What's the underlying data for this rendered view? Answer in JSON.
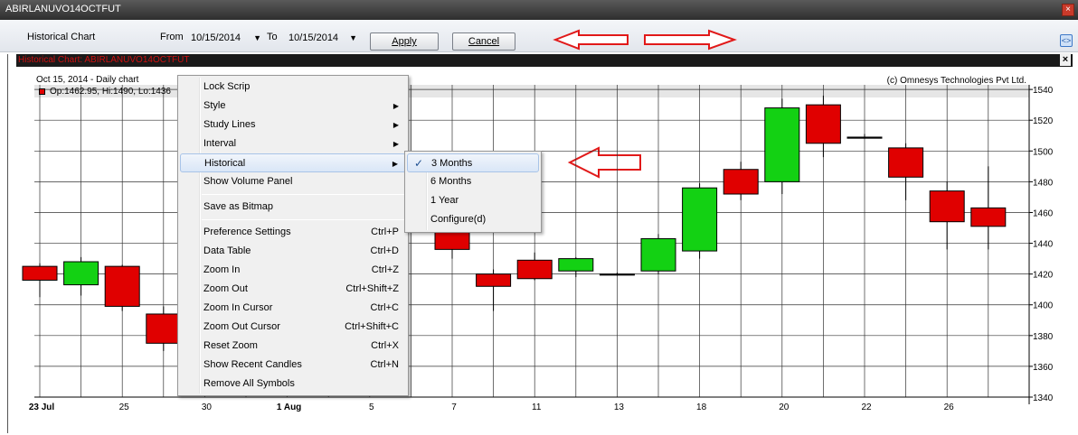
{
  "window": {
    "title": "ABIRLANUVO14OCTFUT"
  },
  "toolbar": {
    "title": "Historical Chart",
    "from_label": "From",
    "from_value": "10/15/2014",
    "to_label": "To",
    "to_value": "10/15/2014",
    "apply_label": "Apply",
    "cancel_label": "Cancel"
  },
  "chart_window": {
    "title": "Historical Chart: ABIRLANUVO14OCTFUT"
  },
  "chart_info": {
    "date_line": "Oct 15, 2014 - Daily chart",
    "ohlc_line": "Op:1462.95, Hi:1490, Lo:1436",
    "copyright": "(c) Omnesys Technologies Pvt Ltd."
  },
  "chart_data": {
    "type": "candlestick",
    "y_ticks": [
      1340,
      1360,
      1380,
      1400,
      1420,
      1440,
      1460,
      1480,
      1500,
      1520,
      1540
    ],
    "ylim": [
      1340,
      1543
    ],
    "x_ticks": [
      {
        "label": "23 Jul",
        "bold": true
      },
      {
        "label": "25",
        "bold": false
      },
      {
        "label": "30",
        "bold": false
      },
      {
        "label": "1 Aug",
        "bold": true
      },
      {
        "label": "5",
        "bold": false
      },
      {
        "label": "7",
        "bold": false
      },
      {
        "label": "11",
        "bold": false
      },
      {
        "label": "13",
        "bold": false
      },
      {
        "label": "18",
        "bold": false
      },
      {
        "label": "20",
        "bold": false
      },
      {
        "label": "22",
        "bold": false
      },
      {
        "label": "26",
        "bold": false
      }
    ],
    "candles": [
      {
        "i": 0,
        "o": 1425,
        "h": 1427,
        "l": 1405,
        "c": 1416
      },
      {
        "i": 1,
        "o": 1413,
        "h": 1431,
        "l": 1406,
        "c": 1428
      },
      {
        "i": 2,
        "o": 1425,
        "h": 1426,
        "l": 1396,
        "c": 1399
      },
      {
        "i": 3,
        "o": 1394,
        "h": 1399,
        "l": 1370,
        "c": 1375
      },
      {
        "i": 10,
        "o": 1448,
        "h": 1452,
        "l": 1430,
        "c": 1436
      },
      {
        "i": 11,
        "o": 1420,
        "h": 1423,
        "l": 1396,
        "c": 1412
      },
      {
        "i": 12,
        "o": 1429,
        "h": 1434,
        "l": 1416,
        "c": 1417
      },
      {
        "i": 13,
        "o": 1422,
        "h": 1431,
        "l": 1418,
        "c": 1430
      },
      {
        "i": 14,
        "o": 1420,
        "h": 1421,
        "l": 1419,
        "c": 1420
      },
      {
        "i": 15,
        "o": 1422,
        "h": 1446,
        "l": 1420,
        "c": 1443
      },
      {
        "i": 16,
        "o": 1435,
        "h": 1479,
        "l": 1430,
        "c": 1476
      },
      {
        "i": 17,
        "o": 1488,
        "h": 1493,
        "l": 1468,
        "c": 1472
      },
      {
        "i": 18,
        "o": 1480,
        "h": 1534,
        "l": 1472,
        "c": 1528
      },
      {
        "i": 19,
        "o": 1530,
        "h": 1536,
        "l": 1496,
        "c": 1505
      },
      {
        "i": 20,
        "o": 1509,
        "h": 1511,
        "l": 1508,
        "c": 1509
      },
      {
        "i": 21,
        "o": 1502,
        "h": 1505,
        "l": 1468,
        "c": 1483
      },
      {
        "i": 22,
        "o": 1474,
        "h": 1480,
        "l": 1436,
        "c": 1454
      },
      {
        "i": 23,
        "o": 1463,
        "h": 1490,
        "l": 1436,
        "c": 1451
      }
    ],
    "colors": {
      "up": "#13d113",
      "down": "#e00000",
      "grid": "#333333"
    }
  },
  "context_menu": {
    "items": [
      {
        "label": "Lock Scrip",
        "shortcut": "",
        "submenu": false
      },
      {
        "label": "Style",
        "shortcut": "",
        "submenu": true
      },
      {
        "label": "Study Lines",
        "shortcut": "",
        "submenu": true
      },
      {
        "label": "Interval",
        "shortcut": "",
        "submenu": true
      },
      {
        "label": "Historical",
        "shortcut": "",
        "submenu": true
      },
      {
        "label": "Show Volume Panel",
        "shortcut": "",
        "submenu": false
      },
      {
        "label": "Save as Bitmap",
        "shortcut": "",
        "submenu": false
      },
      {
        "label": "Preference Settings",
        "shortcut": "Ctrl+P",
        "submenu": false
      },
      {
        "label": "Data Table",
        "shortcut": "Ctrl+D",
        "submenu": false
      },
      {
        "label": "Zoom In",
        "shortcut": "Ctrl+Z",
        "submenu": false
      },
      {
        "label": "Zoom Out",
        "shortcut": "Ctrl+Shift+Z",
        "submenu": false
      },
      {
        "label": "Zoom In Cursor",
        "shortcut": "Ctrl+C",
        "submenu": false
      },
      {
        "label": "Zoom Out Cursor",
        "shortcut": "Ctrl+Shift+C",
        "submenu": false
      },
      {
        "label": "Reset Zoom",
        "shortcut": "Ctrl+X",
        "submenu": false
      },
      {
        "label": "Show Recent Candles",
        "shortcut": "Ctrl+N",
        "submenu": false
      },
      {
        "label": "Remove All Symbols",
        "shortcut": "",
        "submenu": false
      }
    ]
  },
  "historical_submenu": {
    "items": [
      {
        "label": "3 Months",
        "checked": true
      },
      {
        "label": "6 Months",
        "checked": false
      },
      {
        "label": "1 Year",
        "checked": false
      },
      {
        "label": "Configure(d)",
        "checked": false
      }
    ]
  },
  "annotation_color": "#e11919"
}
